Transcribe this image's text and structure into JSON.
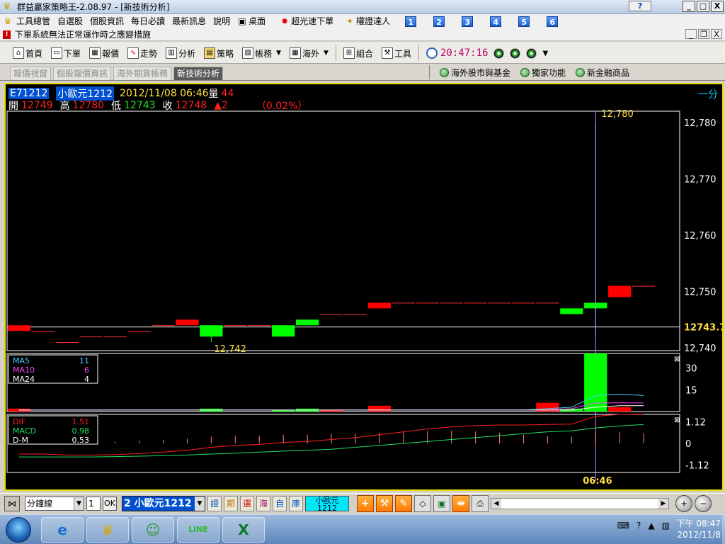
{
  "window": {
    "title": "群益贏家策略王-2.08.97 - [新技術分析]",
    "help_label": "?",
    "minimize": "_",
    "maximize": "□",
    "close": "X"
  },
  "menu": {
    "items": [
      "工具總管",
      "自選股",
      "個股資訊",
      "每日必讀",
      "最新訊息",
      "說明",
      "桌面",
      "超光速下單",
      "權證達人"
    ],
    "numbers": [
      "1",
      "2",
      "3",
      "4",
      "5",
      "6"
    ]
  },
  "notice": {
    "text": "下單系統無法正常運作時之應變措施",
    "mdi_min": "_",
    "mdi_restore": "ā",
    "mdi_close": "X"
  },
  "toolbar": {
    "buttons": [
      "首頁",
      "下單",
      "報價",
      "走勢",
      "分析",
      "策略",
      "帳務",
      "海外",
      "組合",
      "工具"
    ],
    "clock": "20:47:16"
  },
  "tabs": {
    "items": [
      "報價視窗",
      "個股報價資訊",
      "海外期貨帳務",
      "新技術分析"
    ],
    "active_index": 3
  },
  "quicklinks": [
    "海外股市與基金",
    "獨家功能",
    "新金融商品"
  ],
  "quote": {
    "symbol": "E71212",
    "name": "小歐元1212",
    "datetime": "2012/11/08 06:46",
    "volume_label": "量",
    "volume": "44",
    "open_label": "開",
    "open": "12749",
    "high_label": "高",
    "high": "12780",
    "low_label": "低",
    "low": "12743",
    "close_label": "收",
    "close": "12748",
    "change": "▲2",
    "change_pct": "（0.02%）",
    "period": "一分"
  },
  "chart_data": [
    {
      "type": "candlestick",
      "axis_ticks": [
        "12,780",
        "12,770",
        "12,760",
        "12,750",
        "12,740"
      ],
      "ylim": [
        12739.5,
        12782
      ],
      "current_price_label": "12743.7",
      "current_price": 12743.7,
      "annotations": {
        "high": "12,780",
        "low": "12,742"
      },
      "candles": [
        {
          "o": 12743,
          "c": 12744,
          "h": 12744,
          "l": 12743
        },
        {
          "o": 12743,
          "c": 12743,
          "h": 12743,
          "l": 12743
        },
        {
          "o": 12741,
          "c": 12741,
          "h": 12741,
          "l": 12741
        },
        {
          "o": 12742,
          "c": 12742,
          "h": 12742,
          "l": 12742
        },
        {
          "o": 12742,
          "c": 12742,
          "h": 12742,
          "l": 12742
        },
        {
          "o": 12743,
          "c": 12743,
          "h": 12743,
          "l": 12743
        },
        {
          "o": 12744,
          "c": 12744,
          "h": 12744,
          "l": 12744
        },
        {
          "o": 12744,
          "c": 12745,
          "h": 12745,
          "l": 12744
        },
        {
          "o": 12744,
          "c": 12742,
          "h": 12744,
          "l": 12741
        },
        {
          "o": 12744,
          "c": 12744,
          "h": 12744,
          "l": 12744
        },
        {
          "o": 12744,
          "c": 12744,
          "h": 12744,
          "l": 12744
        },
        {
          "o": 12744,
          "c": 12742,
          "h": 12744,
          "l": 12742
        },
        {
          "o": 12745,
          "c": 12744,
          "h": 12745,
          "l": 12744
        },
        {
          "o": 12746,
          "c": 12746,
          "h": 12746,
          "l": 12746
        },
        {
          "o": 12746,
          "c": 12746,
          "h": 12746,
          "l": 12746
        },
        {
          "o": 12747,
          "c": 12748,
          "h": 12748,
          "l": 12747
        },
        {
          "o": 12748,
          "c": 12748,
          "h": 12748,
          "l": 12748
        },
        {
          "o": 12748,
          "c": 12748,
          "h": 12748,
          "l": 12748
        },
        {
          "o": 12748,
          "c": 12748,
          "h": 12748,
          "l": 12748
        },
        {
          "o": 12748,
          "c": 12748,
          "h": 12748,
          "l": 12748
        },
        {
          "o": 12748,
          "c": 12748,
          "h": 12748,
          "l": 12748
        },
        {
          "o": 12748,
          "c": 12748,
          "h": 12748,
          "l": 12748
        },
        {
          "o": 12748,
          "c": 12748,
          "h": 12748,
          "l": 12748
        },
        {
          "o": 12747,
          "c": 12746,
          "h": 12747,
          "l": 12746
        },
        {
          "o": 12748,
          "c": 12747,
          "h": 12780,
          "l": 12742
        },
        {
          "o": 12749,
          "c": 12751,
          "h": 12751,
          "l": 12749
        },
        {
          "o": 12751,
          "c": 12751,
          "h": 12751,
          "l": 12751
        }
      ],
      "rising_color": "#ff0000",
      "falling_color": "#00ff00",
      "crosshair_index": 24,
      "time_label": "06:46"
    },
    {
      "type": "bar",
      "ylim": [
        0,
        40
      ],
      "axis_ticks": [
        "30",
        "15"
      ],
      "legend": [
        {
          "name": "MA5",
          "value": "11",
          "color": "#40d0ff"
        },
        {
          "name": "MA10",
          "value": "6",
          "color": "#ff40ff"
        },
        {
          "name": "MA24",
          "value": "4",
          "color": "#ffffff"
        }
      ],
      "volumes": [
        2,
        0,
        0,
        0,
        0,
        0,
        0,
        0,
        2,
        0,
        0,
        1,
        2,
        1,
        0,
        4,
        0,
        0,
        0,
        0,
        0,
        0,
        6,
        2,
        40,
        3,
        0
      ],
      "ma5": [
        1,
        1,
        1,
        1,
        1,
        1,
        1,
        1,
        1,
        1,
        1,
        1,
        1,
        1,
        1,
        1,
        1,
        1,
        1,
        1,
        1,
        1,
        2,
        3,
        11,
        12,
        11
      ],
      "ma10": [
        1,
        1,
        1,
        1,
        1,
        1,
        1,
        1,
        1,
        1,
        1,
        1,
        1,
        1,
        1,
        1,
        1,
        1,
        1,
        1,
        1,
        1,
        1,
        2,
        6,
        6,
        6
      ],
      "ma24": [
        1,
        1,
        1,
        1,
        1,
        1,
        1,
        1,
        1,
        1,
        1,
        1,
        1,
        1,
        1,
        1,
        1,
        1,
        1,
        1,
        1,
        1,
        1,
        1,
        3,
        4,
        4
      ]
    },
    {
      "type": "line",
      "ylim": [
        -1.5,
        1.5
      ],
      "axis_ticks": [
        "1.12",
        "0",
        "-1.12"
      ],
      "legend": [
        {
          "name": "DIF",
          "value": "1.51",
          "color": "#ff2020"
        },
        {
          "name": "MACD",
          "value": "0.98",
          "color": "#20e060"
        },
        {
          "name": "D-M",
          "value": "0.53",
          "color": "#ffffff"
        }
      ],
      "dif": [
        -0.55,
        -0.55,
        -0.6,
        -0.6,
        -0.58,
        -0.52,
        -0.45,
        -0.35,
        -0.2,
        -0.1,
        -0.05,
        0.05,
        0.1,
        0.2,
        0.3,
        0.45,
        0.6,
        0.75,
        0.85,
        0.92,
        0.95,
        0.95,
        0.98,
        1.0,
        1.4,
        1.5,
        1.51
      ],
      "macd": [
        -0.7,
        -0.7,
        -0.7,
        -0.7,
        -0.68,
        -0.66,
        -0.63,
        -0.6,
        -0.55,
        -0.5,
        -0.45,
        -0.4,
        -0.35,
        -0.3,
        -0.2,
        -0.1,
        0.0,
        0.1,
        0.2,
        0.3,
        0.4,
        0.5,
        0.6,
        0.65,
        0.8,
        0.9,
        0.98
      ],
      "dm": [
        0.1,
        0.15,
        0.1,
        0.1,
        0.1,
        0.14,
        0.18,
        0.25,
        0.35,
        0.4,
        0.4,
        0.45,
        0.45,
        0.5,
        0.5,
        0.55,
        0.6,
        0.65,
        0.65,
        0.62,
        0.55,
        0.45,
        0.38,
        0.35,
        0.6,
        0.6,
        0.53
      ]
    }
  ],
  "bottom": {
    "interval": "分鐘線",
    "count": "1",
    "ok": "OK",
    "symbol_select": "2 小歐元1212",
    "filters": [
      "證",
      "期",
      "選",
      "海",
      "自",
      "庫"
    ],
    "name_card": "小歐元 1212"
  },
  "taskbar": {
    "time": "下午 08:47",
    "date": "2012/11/8"
  }
}
